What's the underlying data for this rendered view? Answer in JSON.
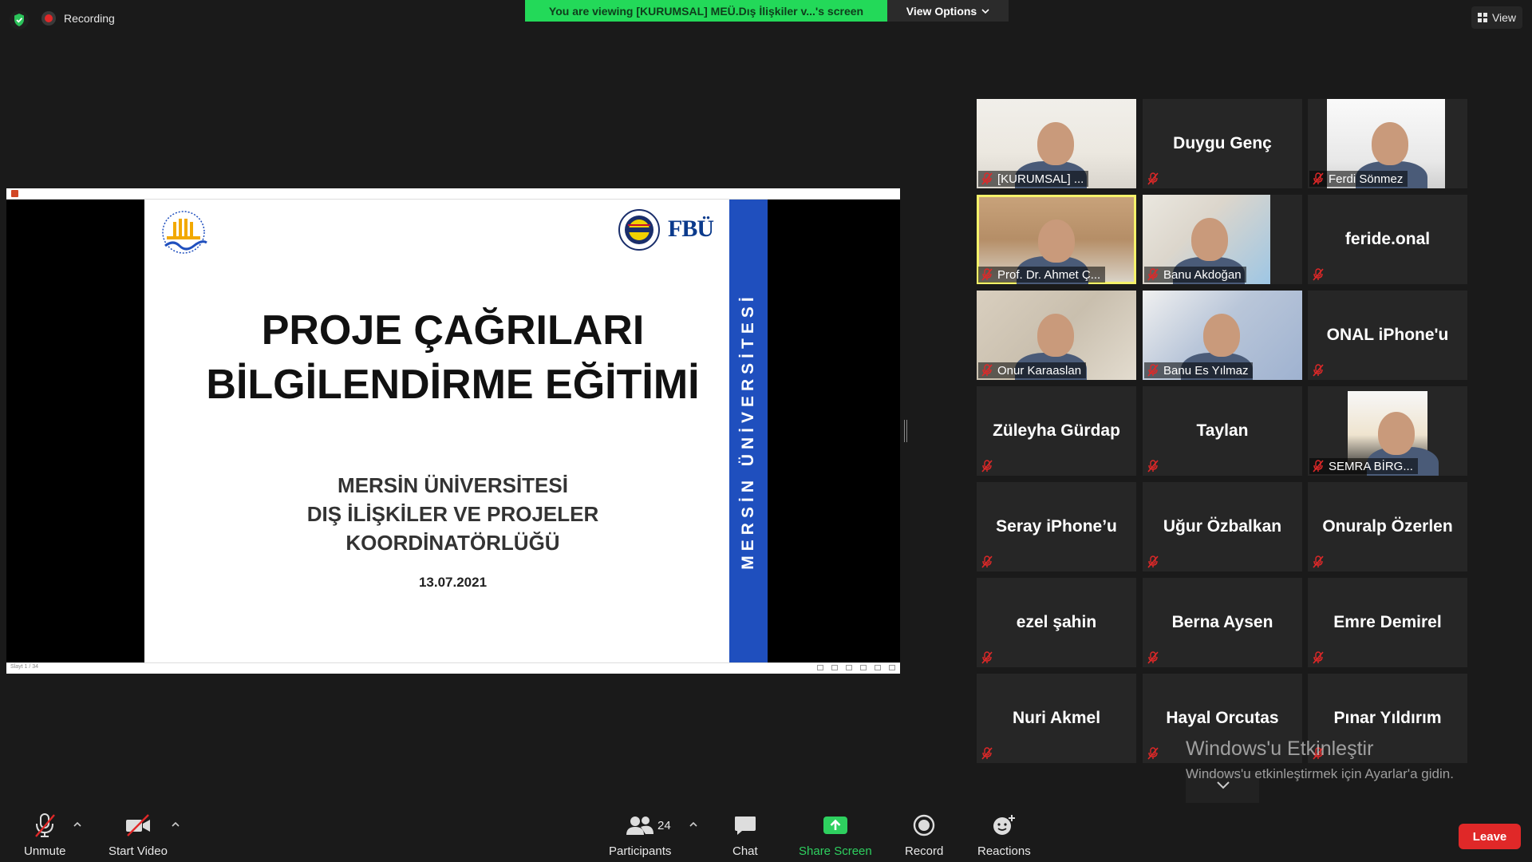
{
  "topbar": {
    "recording_label": "Recording",
    "viewing_banner": "You are viewing [KURUMSAL] MEÜ.Dış İlişkiler v...'s screen",
    "view_options_label": "View Options",
    "view_button_label": "View"
  },
  "slide": {
    "title_line1": "PROJE ÇAĞRILARI",
    "title_line2": "BİLGİLENDİRME EĞİTİMİ",
    "org_line1": "MERSİN ÜNİVERSİTESİ",
    "org_line2": "DIŞ İLİŞKİLER VE PROJELER",
    "org_line3": "KOORDİNATÖRLÜĞÜ",
    "date": "13.07.2021",
    "band_text": "MERSİN ÜNİVERSİTESİ",
    "right_logo_text": "FBÜ",
    "slide_counter": "Slayt 1 / 34"
  },
  "participants": [
    {
      "name": "[KURUMSAL] ...",
      "video": true
    },
    {
      "name": "Duygu Genç",
      "video": false
    },
    {
      "name": "Ferdi Sönmez",
      "video": true
    },
    {
      "name": "Prof. Dr. Ahmet Ç...",
      "video": true,
      "speaking": true
    },
    {
      "name": "Banu Akdoğan",
      "video": true
    },
    {
      "name": "feride.onal",
      "video": false
    },
    {
      "name": "Onur Karaaslan",
      "video": true
    },
    {
      "name": "Banu Es Yılmaz",
      "video": true
    },
    {
      "name": "ONAL iPhone'u",
      "video": false
    },
    {
      "name": "Züleyha Gürdap",
      "video": false
    },
    {
      "name": "Taylan",
      "video": false
    },
    {
      "name": "SEMRA BİRG...",
      "video": true
    },
    {
      "name": "Seray iPhone’u",
      "video": false
    },
    {
      "name": "Uğur Özbalkan",
      "video": false
    },
    {
      "name": "Onuralp Özerlen",
      "video": false
    },
    {
      "name": "ezel şahin",
      "video": false
    },
    {
      "name": "Berna Aysen",
      "video": false
    },
    {
      "name": "Emre Demirel",
      "video": false
    },
    {
      "name": "Nuri Akmel",
      "video": false
    },
    {
      "name": "Hayal Orcutas",
      "video": false
    },
    {
      "name": "Pınar Yıldırım",
      "video": false
    }
  ],
  "watermark": {
    "line1": "Windows'u Etkinleştir",
    "line2": "Windows'u etkinleştirmek için Ayarlar'a gidin."
  },
  "toolbar": {
    "unmute": "Unmute",
    "start_video": "Start Video",
    "participants": "Participants",
    "participant_count": "24",
    "chat": "Chat",
    "share_screen": "Share Screen",
    "record": "Record",
    "reactions": "Reactions",
    "leave": "Leave"
  },
  "colors": {
    "viewing_banner": "#23d959",
    "share_screen": "#2ed05f",
    "leave": "#e02828",
    "active_speaker": "#f5f26a",
    "slide_band": "#1f4fbe"
  },
  "icons": {
    "security": "shield-check-icon",
    "recording": "record-dot-icon",
    "view": "grid-icon",
    "muted": "mic-off-icon",
    "video_off": "camera-off-icon",
    "participants": "people-icon",
    "chat": "chat-bubble-icon",
    "share": "share-arrow-icon",
    "record": "record-icon",
    "reactions": "smiley-plus-icon"
  }
}
